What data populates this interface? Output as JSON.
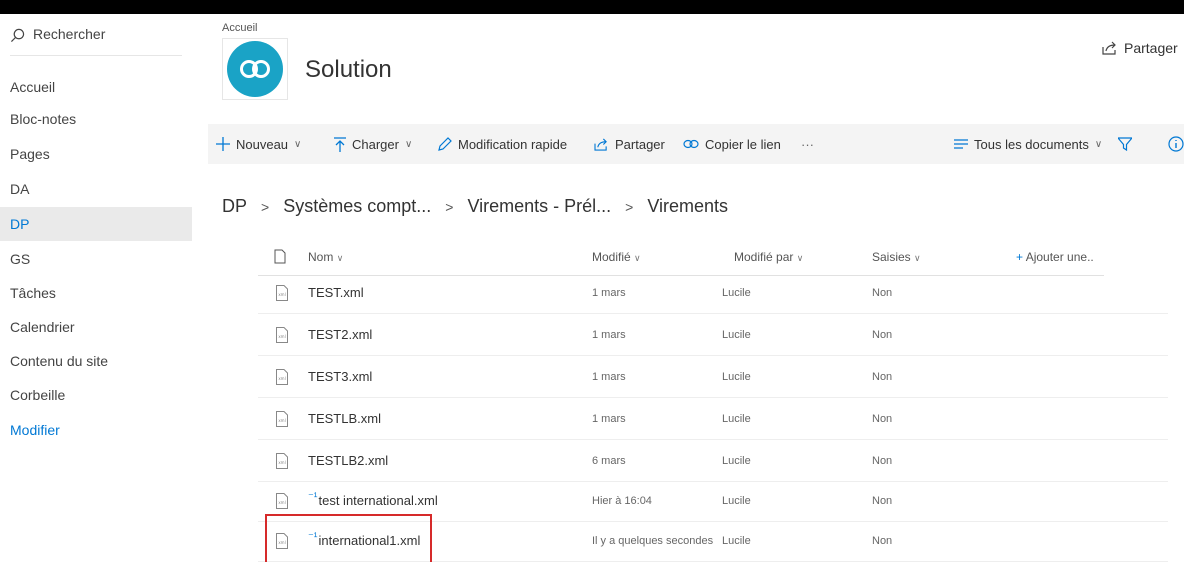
{
  "sidebar": {
    "search_label": "Rechercher",
    "items": [
      {
        "label": "Accueil"
      },
      {
        "label": "Bloc-notes"
      },
      {
        "label": "Pages"
      },
      {
        "label": "DA"
      },
      {
        "label": "DP",
        "active": true
      },
      {
        "label": "GS"
      },
      {
        "label": "Tâches"
      },
      {
        "label": "Calendrier"
      },
      {
        "label": "Contenu du site"
      },
      {
        "label": "Corbeille"
      },
      {
        "label": "Modifier",
        "link": true
      }
    ]
  },
  "header": {
    "breadcrumb_top": "Accueil",
    "site_title": "Solution",
    "share_label": "Partager",
    "logo_color": "#1aa3c6"
  },
  "commandbar": {
    "new_label": "Nouveau",
    "upload_label": "Charger",
    "quick_edit_label": "Modification rapide",
    "share_label": "Partager",
    "copy_link_label": "Copier le lien",
    "more_label": "···",
    "view_label": "Tous les documents"
  },
  "breadcrumb": {
    "items": [
      "DP",
      "Systèmes compt...",
      "Virements - Prél...",
      "Virements"
    ]
  },
  "table": {
    "columns": {
      "name": "Nom",
      "modified": "Modifié",
      "modified_by": "Modifié par",
      "saisies": "Saisies",
      "add_column": "Ajouter une.."
    },
    "rows": [
      {
        "name": "TEST.xml",
        "modified": "1 mars",
        "modified_by": "Lucile",
        "saisies": "Non",
        "new": false
      },
      {
        "name": "TEST2.xml",
        "modified": "1 mars",
        "modified_by": "Lucile",
        "saisies": "Non",
        "new": false
      },
      {
        "name": "TEST3.xml",
        "modified": "1 mars",
        "modified_by": "Lucile",
        "saisies": "Non",
        "new": false
      },
      {
        "name": "TESTLB.xml",
        "modified": "1 mars",
        "modified_by": "Lucile",
        "saisies": "Non",
        "new": false
      },
      {
        "name": "TESTLB2.xml",
        "modified": "6 mars",
        "modified_by": "Lucile",
        "saisies": "Non",
        "new": false
      },
      {
        "name": "test international.xml",
        "modified": "Hier à 16:04",
        "modified_by": "Lucile",
        "saisies": "Non",
        "new": true
      },
      {
        "name": "international1.xml",
        "modified": "Il y a quelques secondes",
        "modified_by": "Lucile",
        "saisies": "Non",
        "new": true
      }
    ]
  },
  "colors": {
    "accent": "#0078d4",
    "highlight": "#d62a2a"
  }
}
